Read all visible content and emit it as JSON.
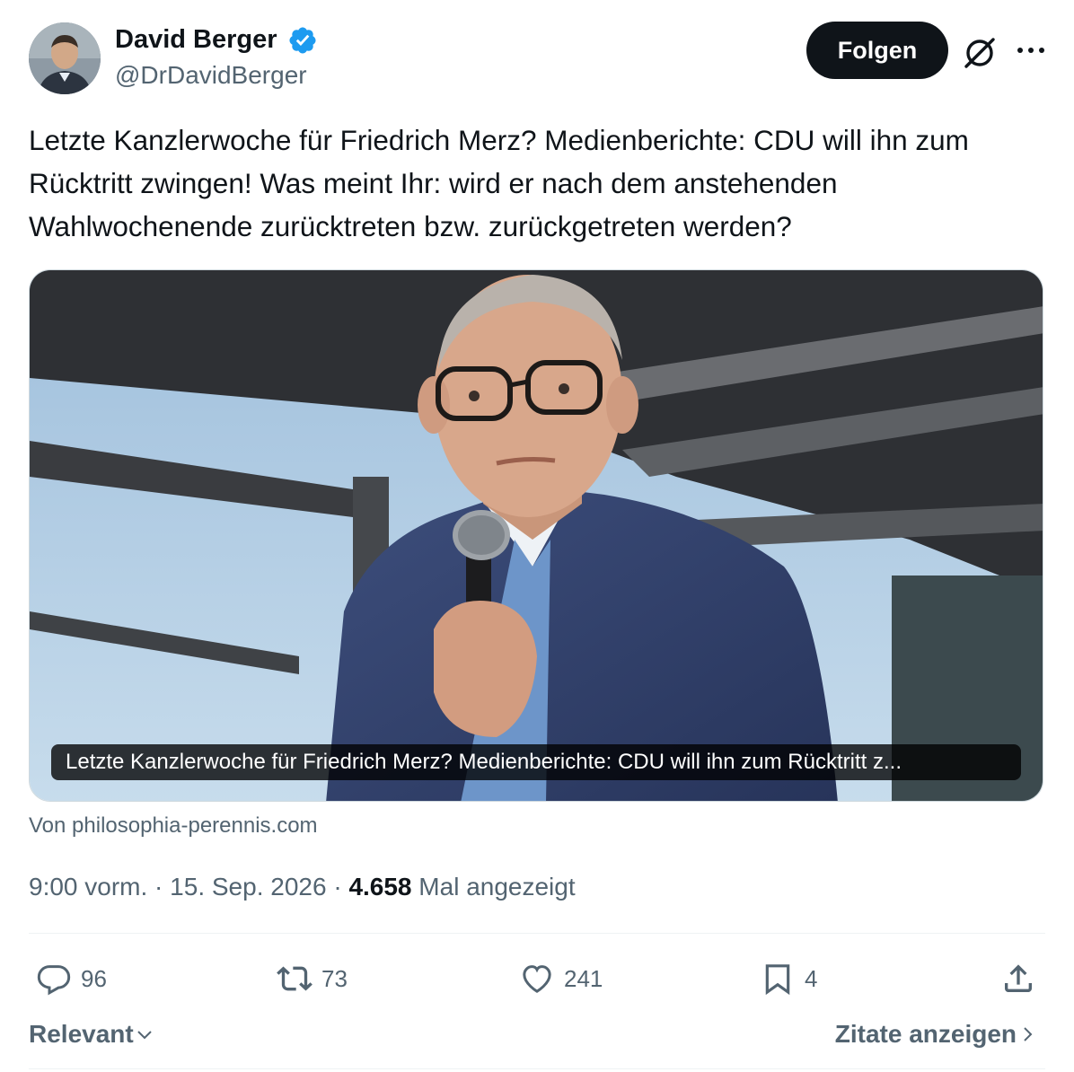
{
  "author": {
    "display_name": "David Berger",
    "handle": "@DrDavidBerger",
    "verified": true,
    "avatar_icon": "profile-photo"
  },
  "header": {
    "follow_label": "Folgen",
    "grok_icon": "slashed-circle-icon",
    "more_icon": "more-dots-icon"
  },
  "tweet": {
    "text": "Letzte Kanzlerwoche für Friedrich Merz? Medienberichte: CDU will ihn zum Rücktritt zwingen! Was meint Ihr: wird er nach dem anstehenden Wahlwochenende zurücktreten bzw. zurückgetreten werden?"
  },
  "card": {
    "caption": "Letzte Kanzlerwoche für Friedrich Merz? Medienberichte: CDU will ihn zum Rücktritt z...",
    "source": "Von philosophia-perennis.com"
  },
  "meta": {
    "time": "9:00 vorm.",
    "sep1": " · ",
    "date": "15. Sep. 2026",
    "sep2": " · ",
    "views": "4.658",
    "views_label": " Mal angezeigt"
  },
  "actions": {
    "replies": "96",
    "reposts": "73",
    "likes": "241",
    "bookmarks": "4"
  },
  "footer": {
    "sort_label": "Relevant",
    "quotes_label": "Zitate anzeigen"
  },
  "colors": {
    "text_primary": "#0f1419",
    "text_secondary": "#536471",
    "verified_blue": "#1d9bf0",
    "divider": "#eff3f4"
  }
}
